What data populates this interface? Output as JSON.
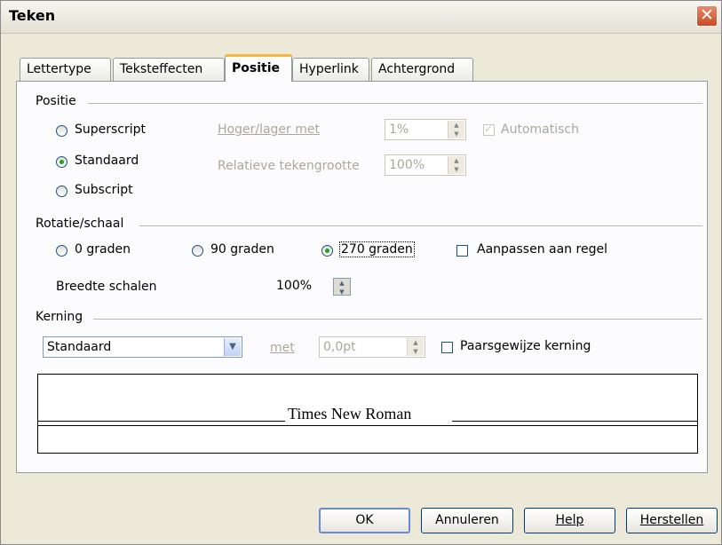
{
  "window": {
    "title": "Teken",
    "close_glyph": "✕"
  },
  "tabs": [
    {
      "label": "Lettertype"
    },
    {
      "label": "Teksteffecten"
    },
    {
      "label": "Positie"
    },
    {
      "label": "Hyperlink"
    },
    {
      "label": "Achtergrond"
    }
  ],
  "positie": {
    "section": "Positie",
    "superscript": "Superscript",
    "standaard": "Standaard",
    "subscript": "Subscript",
    "hoger_label": "Hoger/lager met",
    "hoger_value": "1%",
    "automatisch": "Automatisch",
    "rel_label": "Relatieve tekengrootte",
    "rel_value": "100%"
  },
  "rotatie": {
    "section": "Rotatie/schaal",
    "opt0": "0 graden",
    "opt90": "90 graden",
    "opt270": "270 graden",
    "aanpassen": "Aanpassen aan regel",
    "breedte_label": "Breedte schalen",
    "breedte_value": "100%"
  },
  "kerning": {
    "section": "Kerning",
    "combo_value": "Standaard",
    "met_label": "met",
    "met_value": "0,0pt",
    "paarsgewijze": "Paarsgewijze kerning"
  },
  "preview": {
    "font_name": "Times New Roman"
  },
  "buttons": {
    "ok": "OK",
    "annuleren": "Annuleren",
    "help": "Help",
    "herstellen": "Herstellen"
  }
}
